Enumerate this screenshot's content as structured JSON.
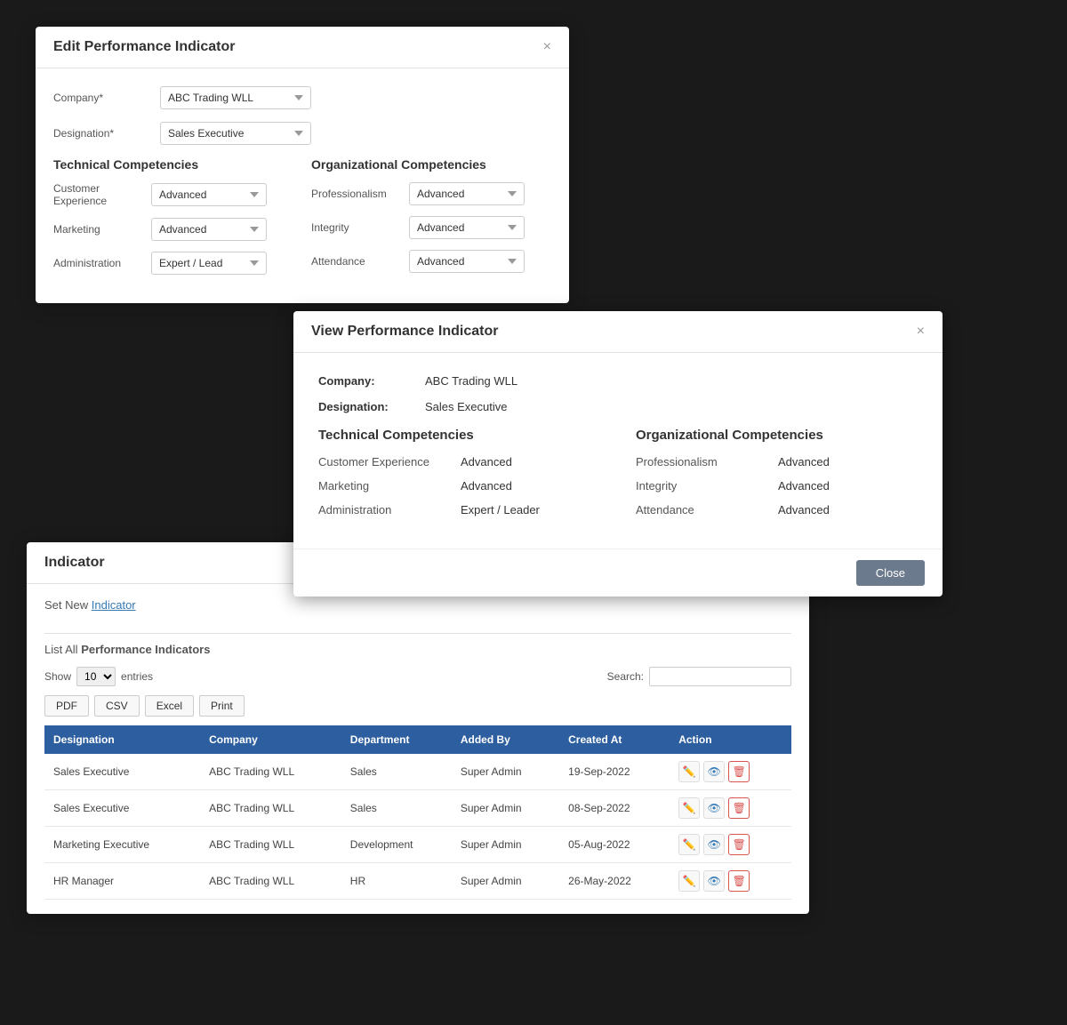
{
  "edit_modal": {
    "title": "Edit Performance Indicator",
    "close_label": "×",
    "company_label": "Company*",
    "company_value": "ABC Trading WLL",
    "designation_label": "Designation*",
    "designation_value": "Sales Executive",
    "technical_title": "Technical Competencies",
    "organizational_title": "Organizational Competencies",
    "technical_items": [
      {
        "label": "Customer Experience",
        "value": "Advanced"
      },
      {
        "label": "Marketing",
        "value": "Advanced"
      },
      {
        "label": "Administration",
        "value": "Expert / Lead"
      }
    ],
    "organizational_items": [
      {
        "label": "Professionalism",
        "value": "Advanced"
      },
      {
        "label": "Integrity",
        "value": "Advanced"
      },
      {
        "label": "Attendance",
        "value": "Advanced"
      }
    ]
  },
  "view_modal": {
    "title": "View Performance Indicator",
    "close_label": "×",
    "company_label": "Company:",
    "company_value": "ABC Trading WLL",
    "designation_label": "Designation:",
    "designation_value": "Sales Executive",
    "technical_title": "Technical Competencies",
    "organizational_title": "Organizational Competencies",
    "technical_items": [
      {
        "label": "Customer Experience",
        "value": "Advanced"
      },
      {
        "label": "Marketing",
        "value": "Advanced"
      },
      {
        "label": "Administration",
        "value": "Expert / Leader"
      }
    ],
    "organizational_items": [
      {
        "label": "Professionalism",
        "value": "Advanced"
      },
      {
        "label": "Integrity",
        "value": "Advanced"
      },
      {
        "label": "Attendance",
        "value": "Advanced"
      }
    ],
    "close_btn_label": "Close"
  },
  "indicator_panel": {
    "title": "Indicator",
    "set_new_prefix": "Set New",
    "set_new_link": "Indicator",
    "list_prefix": "List All",
    "list_link": "Performance Indicators",
    "show_label": "Show",
    "entries_value": "10",
    "entries_label": "entries",
    "search_label": "Search:",
    "export_buttons": [
      "PDF",
      "CSV",
      "Excel",
      "Print"
    ],
    "table": {
      "columns": [
        "Designation",
        "Company",
        "Department",
        "Added By",
        "Created At",
        "Action"
      ],
      "rows": [
        {
          "designation": "Sales Executive",
          "company": "ABC Trading WLL",
          "department": "Sales",
          "added_by": "Super Admin",
          "created_at": "19-Sep-2022"
        },
        {
          "designation": "Sales Executive",
          "company": "ABC Trading WLL",
          "department": "Sales",
          "added_by": "Super Admin",
          "created_at": "08-Sep-2022"
        },
        {
          "designation": "Marketing Executive",
          "company": "ABC Trading WLL",
          "department": "Development",
          "added_by": "Super Admin",
          "created_at": "05-Aug-2022"
        },
        {
          "designation": "HR Manager",
          "company": "ABC Trading WLL",
          "department": "HR",
          "added_by": "Super Admin",
          "created_at": "26-May-2022"
        }
      ]
    }
  }
}
